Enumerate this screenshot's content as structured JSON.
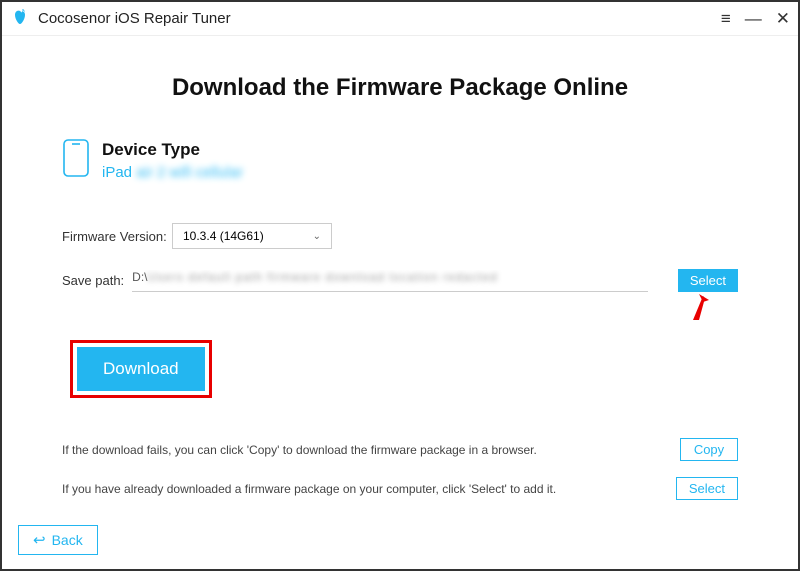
{
  "titlebar": {
    "app_title": "Cocosenor iOS Repair Tuner"
  },
  "page": {
    "title": "Download the Firmware Package Online"
  },
  "device": {
    "label": "Device Type",
    "model_prefix": "iPad",
    "model_rest": "air 2 wifi cellular"
  },
  "form": {
    "firmware_label": "Firmware Version:",
    "firmware_value": "10.3.4 (14G61)",
    "savepath_label": "Save path:",
    "savepath_prefix": "D:\\",
    "savepath_rest": "Users default path firmware download location redacted",
    "select_button": "Select",
    "download_button": "Download"
  },
  "hints": {
    "fail_text": "If the download fails, you can click 'Copy' to download the firmware package in a browser.",
    "already_text": "If you have already downloaded a firmware package on your computer, click 'Select' to add it.",
    "copy_button": "Copy",
    "select_button": "Select"
  },
  "footer": {
    "back": "Back"
  }
}
